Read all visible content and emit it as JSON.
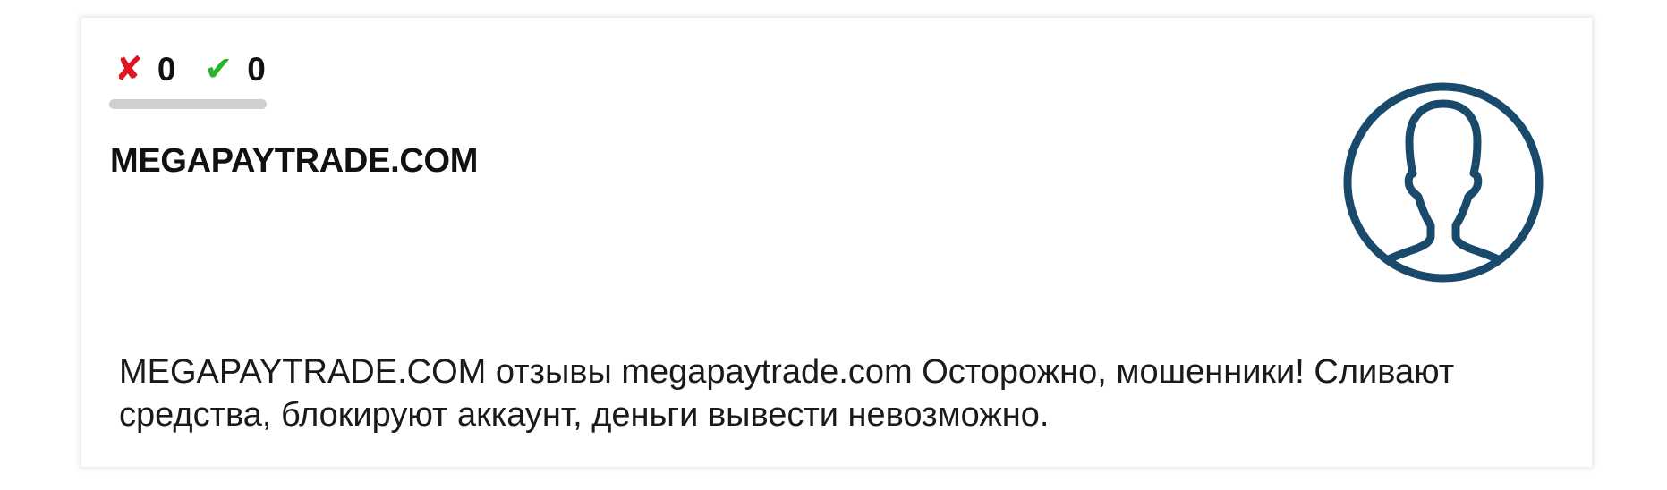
{
  "votes": {
    "dislike_icon": "✘",
    "dislike_count": "0",
    "like_icon": "✔",
    "like_count": "0"
  },
  "title": "MEGAPAYTRADE.COM",
  "avatar_icon": "user-silhouette-icon",
  "description": "MEGAPAYTRADE.COM отзывы megapaytrade.com Осторожно, мошенники! Сливают средства, блокируют аккаунт, деньги вывести невозможно.",
  "colors": {
    "dislike": "#e0141e",
    "like": "#2bb32a",
    "avatar": "#1a4a6b",
    "vote_bar": "#cfcfcf"
  }
}
